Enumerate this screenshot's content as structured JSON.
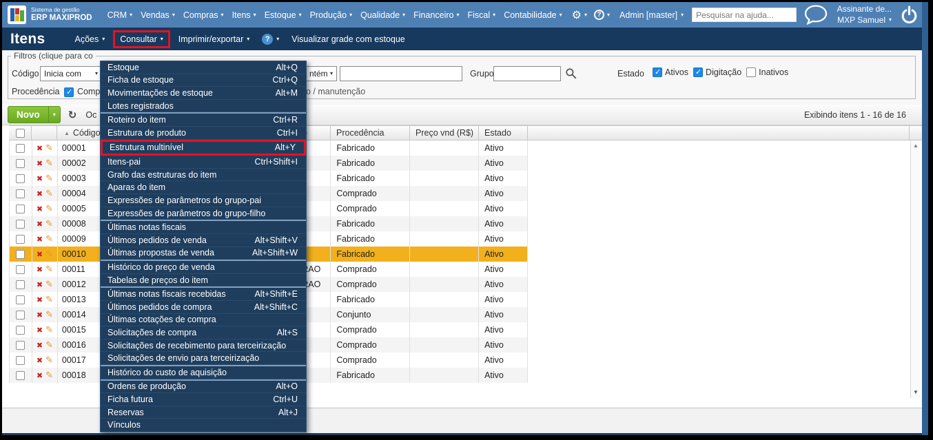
{
  "topbar": {
    "brand_line1": "Sistema de gestão",
    "brand_line2": "ERP MAXIPROD",
    "menus": [
      "CRM",
      "Vendas",
      "Compras",
      "Itens",
      "Estoque",
      "Produção",
      "Qualidade",
      "Financeiro",
      "Fiscal",
      "Contabilidade"
    ],
    "admin_menu": "Admin [master]",
    "search_placeholder": "Pesquisar na ajuda...",
    "account_line1": "Assinante de...",
    "account_line2": "MXP Samuel"
  },
  "pagebar": {
    "title": "Itens",
    "actions_menu": "Ações",
    "consult_menu": "Consultar",
    "print_menu": "Imprimir/exportar",
    "help_glyph": "?",
    "view_grid_label": "Visualizar grade com estoque"
  },
  "filters": {
    "legend": "Filtros (clique para co",
    "codigo_label": "Código",
    "codigo_operator": "Inicia com",
    "operator_fragment": "ntém",
    "codigo_value": "",
    "grupo_label": "Grupo",
    "grupo_value": "",
    "estado_label": "Estado",
    "estado_options": [
      {
        "label": "Ativos",
        "checked": true
      },
      {
        "label": "Digitação",
        "checked": true
      },
      {
        "label": "Inativos",
        "checked": false
      }
    ],
    "procedencia_label": "Procedência",
    "procedencia_fragment": "Comp",
    "procedencia_tail_fragment": "o / manutenção"
  },
  "toolbar": {
    "new_label": "Novo",
    "hide_filters_fragment": "Oc",
    "paging_info": "Exibindo itens 1 - 16 de 16"
  },
  "table": {
    "headers": {
      "codigo": "Código",
      "hidden_col_fragment": "o",
      "procedencia": "Procedência",
      "preco": "Preço vnd (R$)",
      "estado": "Estado"
    },
    "rows": [
      {
        "codigo": "00001",
        "frag": "",
        "procedencia": "Fabricado",
        "preco": "",
        "estado": "Ativo",
        "selected": false
      },
      {
        "codigo": "00002",
        "frag": "",
        "procedencia": "Fabricado",
        "preco": "",
        "estado": "Ativo",
        "selected": false
      },
      {
        "codigo": "00003",
        "frag": "",
        "procedencia": "Fabricado",
        "preco": "",
        "estado": "Ativo",
        "selected": false
      },
      {
        "codigo": "00004",
        "frag": "",
        "procedencia": "Comprado",
        "preco": "",
        "estado": "Ativo",
        "selected": false
      },
      {
        "codigo": "00005",
        "frag": "",
        "procedencia": "Comprado",
        "preco": "",
        "estado": "Ativo",
        "selected": false
      },
      {
        "codigo": "00008",
        "frag": "",
        "procedencia": "Fabricado",
        "preco": "",
        "estado": "Ativo",
        "selected": false
      },
      {
        "codigo": "00009",
        "frag": "",
        "procedencia": "Fabricado",
        "preco": "",
        "estado": "Ativo",
        "selected": false
      },
      {
        "codigo": "00010",
        "frag": "",
        "procedencia": "Fabricado",
        "preco": "",
        "estado": "Ativo",
        "selected": true
      },
      {
        "codigo": "00011",
        "frag": "RAO",
        "procedencia": "Comprado",
        "preco": "",
        "estado": "Ativo",
        "selected": false
      },
      {
        "codigo": "00012",
        "frag": "RAO",
        "procedencia": "Comprado",
        "preco": "",
        "estado": "Ativo",
        "selected": false
      },
      {
        "codigo": "00013",
        "frag": "",
        "procedencia": "Fabricado",
        "preco": "",
        "estado": "Ativo",
        "selected": false
      },
      {
        "codigo": "00014",
        "frag": "",
        "procedencia": "Conjunto",
        "preco": "",
        "estado": "Ativo",
        "selected": false
      },
      {
        "codigo": "00015",
        "frag": "",
        "procedencia": "Comprado",
        "preco": "",
        "estado": "Ativo",
        "selected": false
      },
      {
        "codigo": "00016",
        "frag": "",
        "procedencia": "Comprado",
        "preco": "",
        "estado": "Ativo",
        "selected": false
      },
      {
        "codigo": "00017",
        "frag": "",
        "procedencia": "Comprado",
        "preco": "",
        "estado": "Ativo",
        "selected": false
      },
      {
        "codigo": "00018",
        "frag": "",
        "procedencia": "Fabricado",
        "preco": "",
        "estado": "Ativo",
        "selected": false
      }
    ]
  },
  "consult_dropdown": {
    "items": [
      {
        "label": "Estoque",
        "shortcut": "Alt+Q"
      },
      {
        "label": "Ficha de estoque",
        "shortcut": "Ctrl+Q"
      },
      {
        "label": "Movimentações de estoque",
        "shortcut": "Alt+M"
      },
      {
        "label": "Lotes registrados",
        "shortcut": ""
      },
      {
        "label": "Roteiro do item",
        "shortcut": "Ctrl+R",
        "sep_before": true
      },
      {
        "label": "Estrutura de produto",
        "shortcut": "Ctrl+I"
      },
      {
        "label": "Estrutura multinível",
        "shortcut": "Alt+Y",
        "highlighted": true
      },
      {
        "label": "Itens-pai",
        "shortcut": "Ctrl+Shift+I"
      },
      {
        "label": "Grafo das estruturas do item",
        "shortcut": ""
      },
      {
        "label": "Aparas do item",
        "shortcut": ""
      },
      {
        "label": "Expressões de parâmetros do grupo-pai",
        "shortcut": ""
      },
      {
        "label": "Expressões de parâmetros do grupo-filho",
        "shortcut": ""
      },
      {
        "label": "Últimas notas fiscais",
        "shortcut": "",
        "sep_before": true
      },
      {
        "label": "Últimos pedidos de venda",
        "shortcut": "Alt+Shift+V"
      },
      {
        "label": "Últimas propostas de venda",
        "shortcut": "Alt+Shift+W"
      },
      {
        "label": "Histórico do preço de venda",
        "shortcut": "",
        "sep_before": true
      },
      {
        "label": "Tabelas de preços do item",
        "shortcut": ""
      },
      {
        "label": "Últimas notas fiscais recebidas",
        "shortcut": "Alt+Shift+E",
        "sep_before": true
      },
      {
        "label": "Últimos pedidos de compra",
        "shortcut": "Alt+Shift+C"
      },
      {
        "label": "Últimas cotações de compra",
        "shortcut": ""
      },
      {
        "label": "Solicitações de compra",
        "shortcut": "Alt+S"
      },
      {
        "label": "Solicitações de recebimento para terceirização",
        "shortcut": ""
      },
      {
        "label": "Solicitações de envio para terceirização",
        "shortcut": ""
      },
      {
        "label": "Histórico do custo de aquisição",
        "shortcut": "",
        "sep_before": true
      },
      {
        "label": "Ordens de produção",
        "shortcut": "Alt+O",
        "sep_before": true
      },
      {
        "label": "Ficha futura",
        "shortcut": "Ctrl+U"
      },
      {
        "label": "Reservas",
        "shortcut": "Alt+J"
      },
      {
        "label": "Vínculos",
        "shortcut": ""
      }
    ]
  },
  "icons": {
    "gear": "⚙",
    "sort_asc": "▲",
    "refresh": "↻",
    "delete": "✖",
    "edit": "✎",
    "scroll_up": "▲",
    "scroll_down": "▼"
  },
  "colors": {
    "topbar_blue": "#4e80b4",
    "navy": "#17395d",
    "menu_bg": "#1f3e5e",
    "accent_red": "#e81123",
    "selected_row": "#f2b01c",
    "green_button": "#76b82a",
    "checkbox_blue": "#1e88e5"
  }
}
